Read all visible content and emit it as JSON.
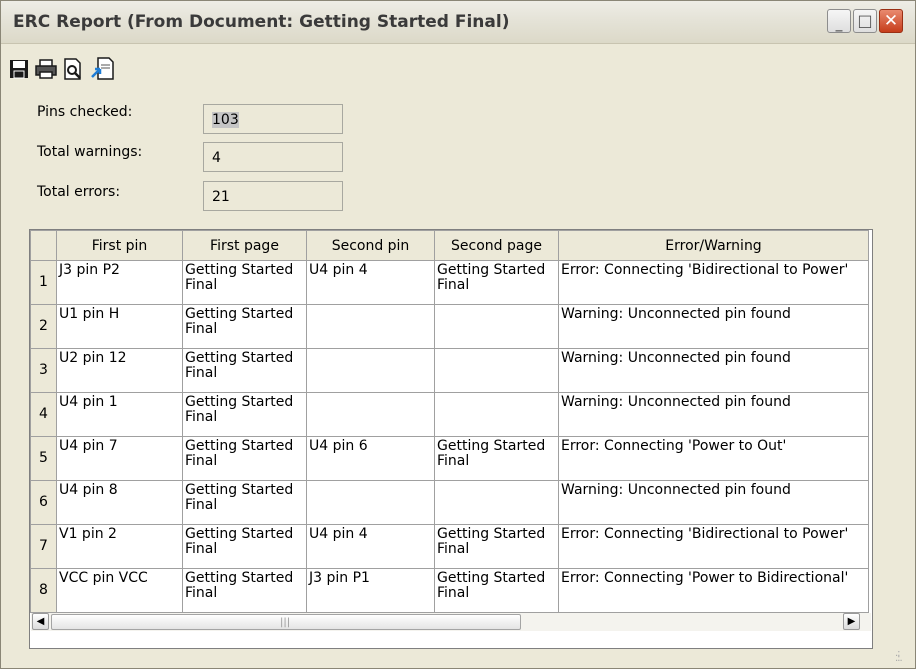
{
  "window": {
    "title": "ERC Report (From Document: Getting Started Final)"
  },
  "controls": {
    "minimize": "_",
    "maximize": "□",
    "close": "✕"
  },
  "toolbar": {
    "icons": [
      "save-icon",
      "print-icon",
      "print-preview-icon",
      "export-icon"
    ]
  },
  "summary": {
    "pins_checked_label": "Pins checked:",
    "pins_checked_value": "103",
    "total_warnings_label": "Total warnings:",
    "total_warnings_value": "4",
    "total_errors_label": "Total errors:",
    "total_errors_value": "21"
  },
  "table": {
    "columns": [
      "First pin",
      "First page",
      "Second pin",
      "Second page",
      "Error/Warning"
    ],
    "rows": [
      [
        "1",
        "J3 pin P2",
        "Getting Started Final",
        "U4 pin 4",
        "Getting Started Final",
        "Error: Connecting 'Bidirectional to Power'"
      ],
      [
        "2",
        "U1 pin H",
        "Getting Started Final",
        "",
        "",
        "Warning: Unconnected pin found"
      ],
      [
        "3",
        "U2 pin 12",
        "Getting Started Final",
        "",
        "",
        "Warning: Unconnected pin found"
      ],
      [
        "4",
        "U4 pin 1",
        "Getting Started Final",
        "",
        "",
        "Warning: Unconnected pin found"
      ],
      [
        "5",
        "U4 pin 7",
        "Getting Started Final",
        "U4 pin 6",
        "Getting Started Final",
        "Error: Connecting 'Power to Out'"
      ],
      [
        "6",
        "U4 pin 8",
        "Getting Started Final",
        "",
        "",
        "Warning: Unconnected pin found"
      ],
      [
        "7",
        "V1 pin 2",
        "Getting Started Final",
        "U4 pin 4",
        "Getting Started Final",
        "Error: Connecting 'Bidirectional to Power'"
      ],
      [
        "8",
        "VCC pin VCC",
        "Getting Started Final",
        "J3 pin P1",
        "Getting Started Final",
        "Error: Connecting 'Power to Bidirectional'"
      ]
    ]
  },
  "scrollbars": {
    "up": "▲",
    "down": "▼",
    "left": "◀",
    "right": "▶",
    "grip_v": "≡",
    "grip_h": "|||"
  }
}
